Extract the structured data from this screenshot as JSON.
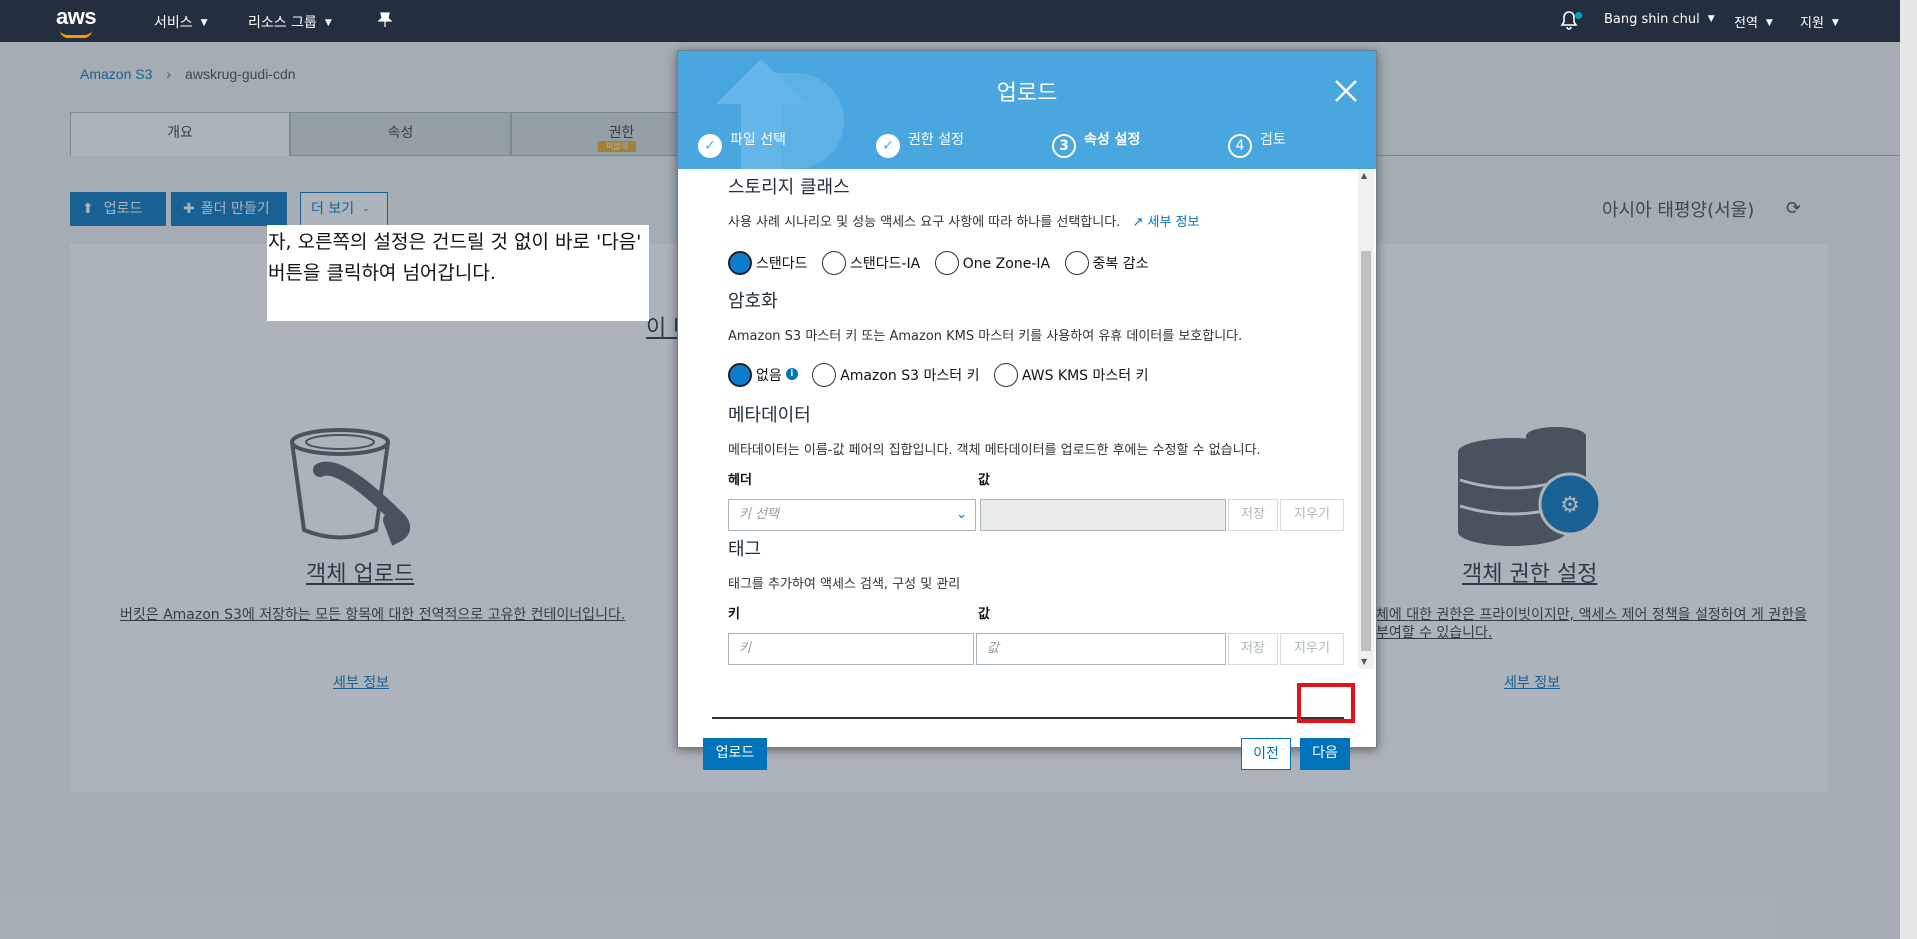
{
  "nav": {
    "logo": "aws",
    "services": "서비스",
    "resource_groups": "리소스 그룹",
    "user": "Bang shin chul",
    "region": "전역",
    "support": "지원"
  },
  "breadcrumb": {
    "root": "Amazon S3",
    "current": "awskrug-gudi-cdn"
  },
  "tabs": {
    "overview": "개요",
    "properties": "속성",
    "permissions": "권한",
    "beta": "퍼블릭"
  },
  "toolbar": {
    "upload": "업로드",
    "new_folder": "폴더 만들기",
    "more": "더 보기"
  },
  "region_label": "아시아 태평양(서울)",
  "tiles": {
    "upload_title": "객체 업로드",
    "upload_desc": "버킷은 Amazon S3에 저장하는 모든 항목에 대한 전역적으로 고유한 컨테이너입니다.",
    "upload_link": "세부 정보",
    "partial_title": "이 버",
    "perm_title": "객체 권한 설정",
    "perm_desc": "체에 대한 권한은 프라이빗이지만, 액세스 제어 정책을 설정하여 게 권한을 부여할 수 있습니다.",
    "perm_link": "세부 정보"
  },
  "caption": "자, 오른쪽의 설정은 건드릴 것 없이 바로 '다음' 버튼을 클릭하여 넘어갑니다.",
  "modal": {
    "title": "업로드",
    "steps": [
      {
        "label": "파일 선택",
        "mark": "✓"
      },
      {
        "label": "권한 설정",
        "mark": "✓"
      },
      {
        "label": "속성 설정",
        "mark": "3"
      },
      {
        "label": "검토",
        "mark": "4"
      }
    ],
    "storage": {
      "title": "스토리지 클래스",
      "desc": "사용 사례 시나리오 및 성능 액세스 요구 사항에 따라 하나를 선택합니다.",
      "more": "세부 정보",
      "options": [
        "스탠다드",
        "스탠다드-IA",
        "One Zone-IA",
        "중복 감소"
      ],
      "selected": "스탠다드"
    },
    "encryption": {
      "title": "암호화",
      "desc": "Amazon S3 마스터 키 또는 Amazon KMS 마스터 키를 사용하여 유휴 데이터를 보호합니다.",
      "options": [
        "없음",
        "Amazon S3 마스터 키",
        "AWS KMS 마스터 키"
      ],
      "selected": "없음"
    },
    "metadata": {
      "title": "메타데이터",
      "desc": "메타데이터는 이름-값 페어의 집합입니다. 객체 메타데이터를 업로드한 후에는 수정할 수 없습니다.",
      "header_label": "헤더",
      "value_label": "값",
      "key_placeholder": "키 선택",
      "save": "저장",
      "clear": "지우기"
    },
    "tags": {
      "title": "태그",
      "desc": "태그를 추가하여 액세스 검색, 구성 및 관리",
      "key_label": "키",
      "value_label": "값",
      "key_placeholder": "키",
      "value_placeholder": "값",
      "save": "저장",
      "clear": "지우기"
    },
    "footer": {
      "upload": "업로드",
      "prev": "이전",
      "next": "다음"
    }
  }
}
